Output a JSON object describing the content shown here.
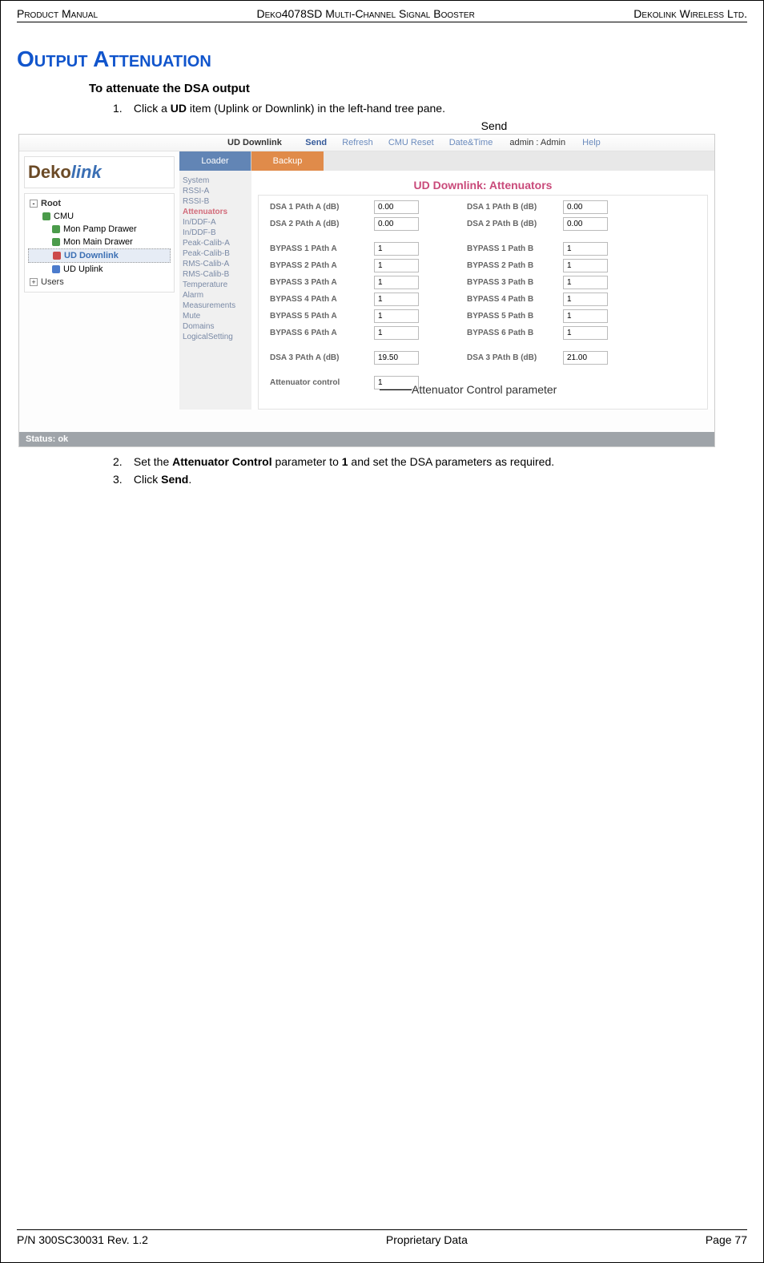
{
  "header": {
    "left": "Product Manual",
    "center": "Deko4078SD Multi-Channel Signal Booster",
    "right": "Dekolink Wireless Ltd."
  },
  "section_title": "Output Attenuation",
  "subtitle": "To attenuate the DSA output",
  "steps": {
    "s1_num": "1.",
    "s1_a": "Click a ",
    "s1_b": "UD",
    "s1_c": " item (Uplink or Downlink) in the left-hand tree pane.",
    "s2_num": "2.",
    "s2_a": "Set the ",
    "s2_b": "Attenuator Control",
    "s2_c": " parameter to ",
    "s2_d": "1",
    "s2_e": " and set the DSA parameters as required.",
    "s3_num": "3.",
    "s3_a": "Click ",
    "s3_b": "Send",
    "s3_c": "."
  },
  "callouts": {
    "send": "Send",
    "attn": "Attenuator Control parameter"
  },
  "app": {
    "topbar": {
      "context": "UD Downlink",
      "send": "Send",
      "refresh": "Refresh",
      "cmu": "CMU Reset",
      "datetime": "Date&Time",
      "admin": "admin : Admin",
      "help": "Help"
    },
    "tabs": {
      "loader": "Loader",
      "backup": "Backup"
    },
    "logo": {
      "a": "Deko",
      "b": "link"
    },
    "tree": {
      "root": "Root",
      "cmu": "CMU",
      "mon_pamp": "Mon Pamp Drawer",
      "mon_main": "Mon Main Drawer",
      "ud_dl": "UD Downlink",
      "ud_ul": "UD Uplink",
      "users": "Users"
    },
    "sidenav": {
      "n0": "System",
      "n1": "RSSI-A",
      "n2": "RSSI-B",
      "n3": "Attenuators",
      "n4": "In/DDF-A",
      "n5": "In/DDF-B",
      "n6": "Peak-Calib-A",
      "n7": "Peak-Calib-B",
      "n8": "RMS-Calib-A",
      "n9": "RMS-Calib-B",
      "n10": "Temperature",
      "n11": "Alarm",
      "n12": "Measurements",
      "n13": "Mute",
      "n14": "Domains",
      "n15": "LogicalSetting"
    },
    "panel_title": "UD Downlink: Attenuators",
    "params": {
      "dsa1a_l": "DSA 1 PAth A (dB)",
      "dsa1a_v": "0.00",
      "dsa1b_l": "DSA 1 PAth B (dB)",
      "dsa1b_v": "0.00",
      "dsa2a_l": "DSA 2 PAth A (dB)",
      "dsa2a_v": "0.00",
      "dsa2b_l": "DSA 2 PAth B (dB)",
      "dsa2b_v": "0.00",
      "b1a_l": "BYPASS 1 PAth A",
      "b1a_v": "1",
      "b1b_l": "BYPASS 1 Path B",
      "b1b_v": "1",
      "b2a_l": "BYPASS 2 PAth A",
      "b2a_v": "1",
      "b2b_l": "BYPASS 2 Path B",
      "b2b_v": "1",
      "b3a_l": "BYPASS 3 PAth A",
      "b3a_v": "1",
      "b3b_l": "BYPASS 3 Path B",
      "b3b_v": "1",
      "b4a_l": "BYPASS 4 PAth A",
      "b4a_v": "1",
      "b4b_l": "BYPASS 4 Path B",
      "b4b_v": "1",
      "b5a_l": "BYPASS 5 PAth A",
      "b5a_v": "1",
      "b5b_l": "BYPASS 5 Path B",
      "b5b_v": "1",
      "b6a_l": "BYPASS 6 PAth A",
      "b6a_v": "1",
      "b6b_l": "BYPASS 6 Path B",
      "b6b_v": "1",
      "dsa3a_l": "DSA 3 PAth A (dB)",
      "dsa3a_v": "19.50",
      "dsa3b_l": "DSA 3 PAth B (dB)",
      "dsa3b_v": "21.00",
      "attn_l": "Attenuator control",
      "attn_v": "1"
    },
    "status": "Status: ok"
  },
  "footer": {
    "left": "P/N 300SC30031 Rev. 1.2",
    "center": "Proprietary Data",
    "right": "Page 77"
  }
}
